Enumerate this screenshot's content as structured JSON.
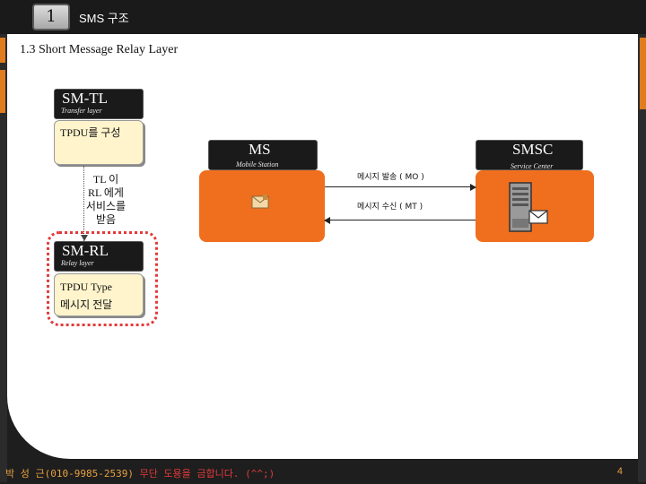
{
  "header": {
    "chapter_number": "1",
    "chapter_title": "SMS 구조"
  },
  "section_title": "1.3 Short Message Relay Layer",
  "stack": {
    "sm_tl": {
      "title": "SM-TL",
      "subtitle": "Transfer layer"
    },
    "tpdu_compose": "TPDU를 구성",
    "tl_note": "TL 이 RL 에게 서비스를 받음",
    "sm_rl": {
      "title": "SM-RL",
      "subtitle": "Relay layer"
    },
    "tpdu_type": "TPDU Type",
    "message_delivery": "메시지 전달"
  },
  "ms": {
    "title": "MS",
    "subtitle": "Mobile Station"
  },
  "smsc": {
    "title": "SMSC",
    "subtitle": "Service Center"
  },
  "arrows": {
    "mo_label": "메시지 발송 ( MO )",
    "mt_label": "메시지 수신 ( MT )"
  },
  "footer": {
    "author": "박 성 근(010-9985-2539)",
    "notice": " 무단 도용을 금합니다. (^^;)",
    "page_number": "4"
  },
  "colors": {
    "accent_orange": "#ef6f1e",
    "highlight_red": "#e23a3a",
    "note_fill": "#fff4cc",
    "dark": "#1a1a1a"
  }
}
